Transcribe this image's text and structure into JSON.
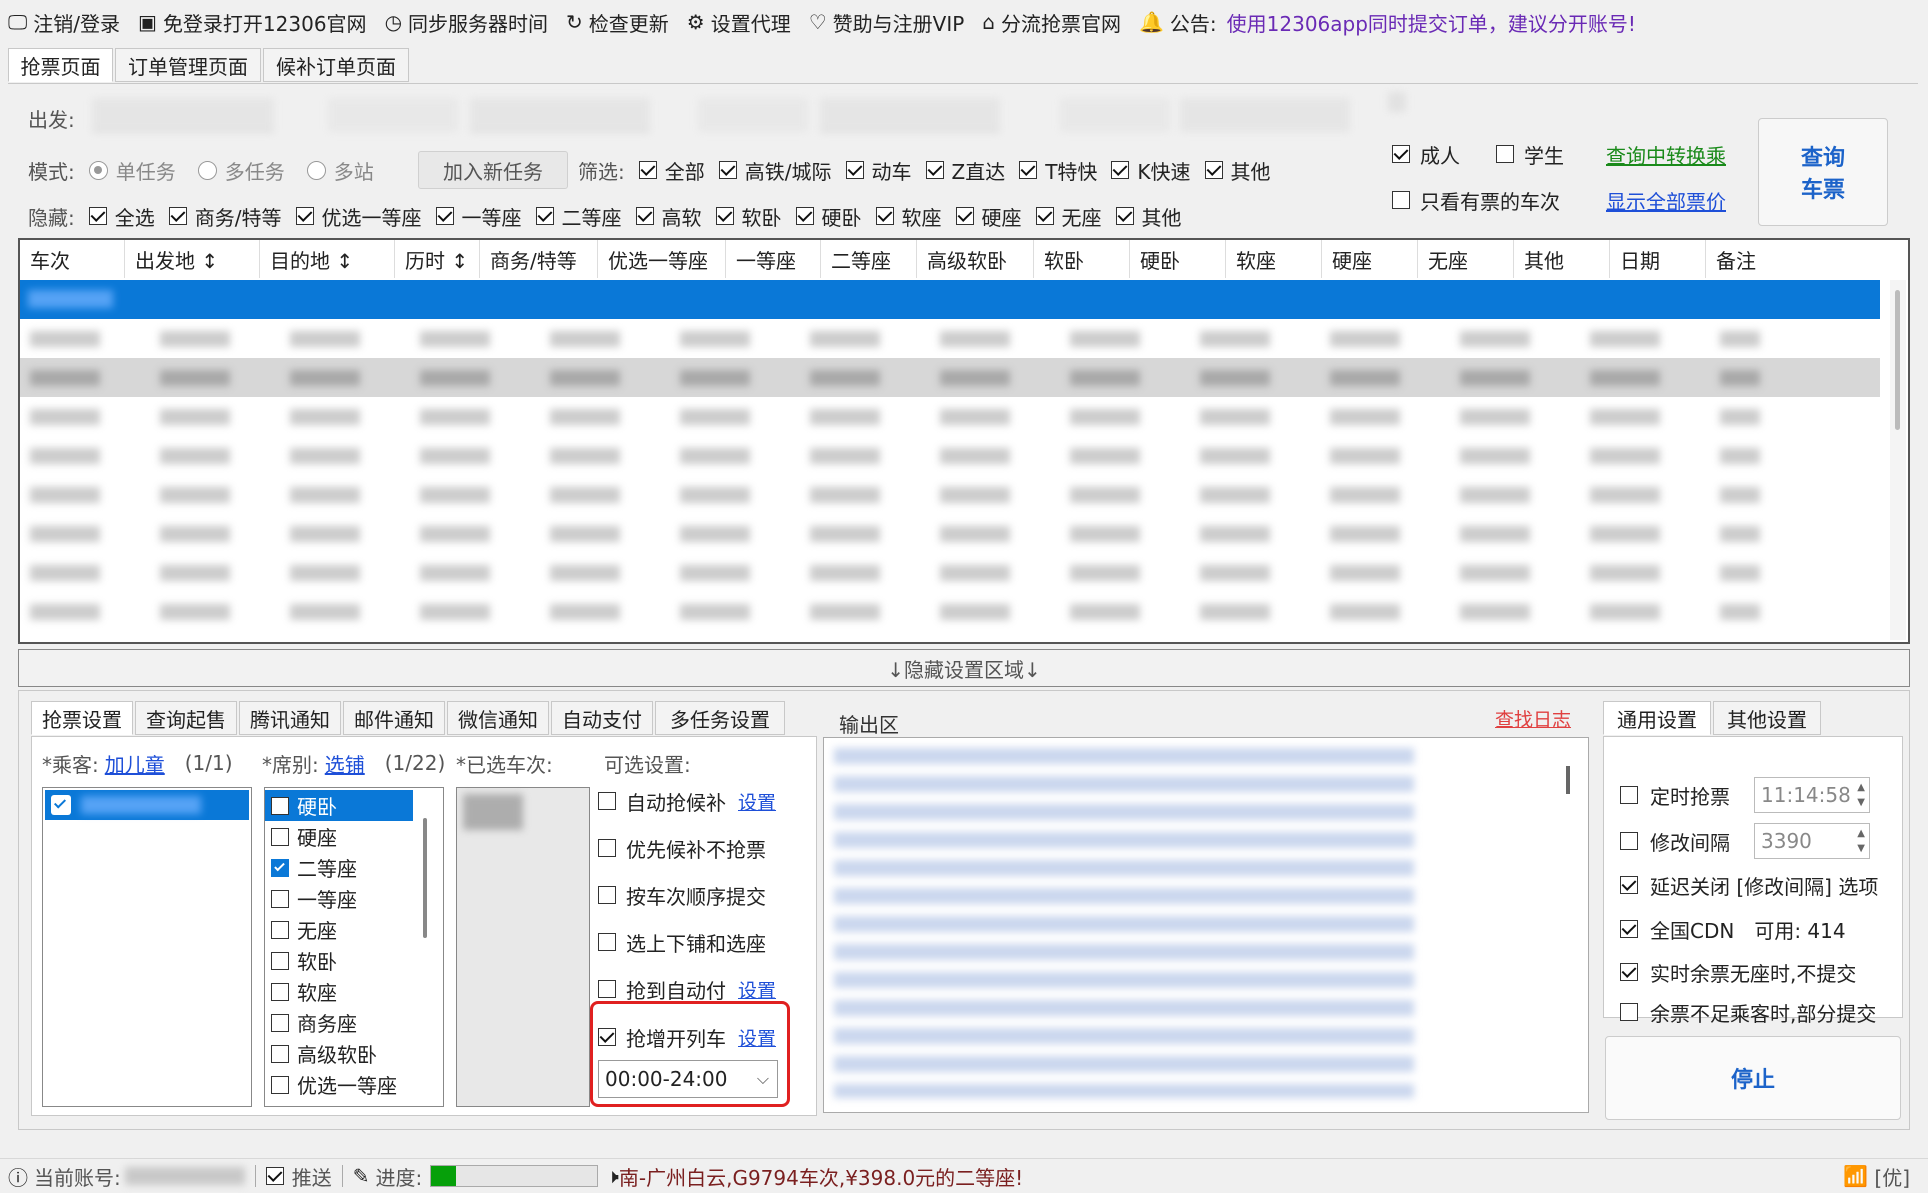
{
  "toolbar": {
    "items": [
      {
        "icon": "monitor-icon",
        "label": "注销/登录"
      },
      {
        "icon": "window-icon",
        "label": "免登录打开12306官网"
      },
      {
        "icon": "clock-icon",
        "label": "同步服务器时间"
      },
      {
        "icon": "refresh-icon",
        "label": "检查更新"
      },
      {
        "icon": "gear-icon",
        "label": "设置代理"
      },
      {
        "icon": "heart-icon",
        "label": "赞助与注册VIP"
      },
      {
        "icon": "home-icon",
        "label": "分流抢票官网"
      }
    ],
    "notice_label": "公告:",
    "notice_text": "使用12306app同时提交订单，建议分开账号!"
  },
  "main_tabs": [
    "抢票页面",
    "订单管理页面",
    "候补订单页面"
  ],
  "query": {
    "from_label": "出发:",
    "mode_label": "模式:",
    "modes": [
      "单任务",
      "多任务",
      "多站"
    ],
    "add_task": "加入新任务",
    "filter_label": "筛选:",
    "filters": [
      "全部",
      "高铁/城际",
      "动车",
      "Z直达",
      "T特快",
      "K快速",
      "其他"
    ],
    "hide_label": "隐藏:",
    "hides": [
      "全选",
      "商务/特等",
      "优选一等座",
      "一等座",
      "二等座",
      "高软",
      "软卧",
      "硬卧",
      "软座",
      "硬座",
      "无座",
      "其他"
    ],
    "adult": "成人",
    "student": "学生",
    "transfer_link": "查询中转换乘",
    "only_tickets": "只看有票的车次",
    "show_prices_link": "显示全部票价",
    "query_btn_line1": "查询",
    "query_btn_line2": "车票"
  },
  "table": {
    "headers": [
      "车次",
      "出发地 ↕",
      "目的地 ↕",
      "历时 ↕",
      "商务/特等",
      "优选一等座",
      "一等座",
      "二等座",
      "高级软卧",
      "软卧",
      "硬卧",
      "软座",
      "硬座",
      "无座",
      "其他",
      "日期",
      "备注"
    ]
  },
  "hidden_bar": "↓隐藏设置区域↓",
  "settings_tabs": [
    "抢票设置",
    "查询起售",
    "腾讯通知",
    "邮件通知",
    "微信通知",
    "自动支付",
    "多任务设置"
  ],
  "passenger": {
    "label": "*乘客:",
    "link": "加儿童",
    "count": "(1/1)"
  },
  "seat": {
    "label": "*席别:",
    "link": "选铺",
    "count": "(1/22)",
    "items": [
      {
        "name": "硬卧",
        "checked": false,
        "selected": true
      },
      {
        "name": "硬座",
        "checked": false,
        "selected": false
      },
      {
        "name": "二等座",
        "checked": true,
        "selected": false
      },
      {
        "name": "一等座",
        "checked": false,
        "selected": false
      },
      {
        "name": "无座",
        "checked": false,
        "selected": false
      },
      {
        "name": "软卧",
        "checked": false,
        "selected": false
      },
      {
        "name": "软座",
        "checked": false,
        "selected": false
      },
      {
        "name": "商务座",
        "checked": false,
        "selected": false
      },
      {
        "name": "高级软卧",
        "checked": false,
        "selected": false
      },
      {
        "name": "优选一等座",
        "checked": false,
        "selected": false
      }
    ]
  },
  "chosen_trains_label": "*已选车次:",
  "options": {
    "label": "可选设置:",
    "items": [
      {
        "label": "自动抢候补",
        "checked": false,
        "link": "设置"
      },
      {
        "label": "优先候补不抢票",
        "checked": false,
        "link": ""
      },
      {
        "label": "按车次顺序提交",
        "checked": false,
        "link": ""
      },
      {
        "label": "选上下铺和选座",
        "checked": false,
        "link": ""
      },
      {
        "label": "抢到自动付",
        "checked": false,
        "link": "设置"
      },
      {
        "label": "抢增开列车",
        "checked": true,
        "link": "设置"
      }
    ],
    "time_range": "00:00-24:00"
  },
  "output": {
    "label": "输出区",
    "log_link": "查找日志"
  },
  "general_tabs": [
    "通用设置",
    "其他设置"
  ],
  "general": {
    "timed_label": "定时抢票",
    "timed_value": "11:14:58",
    "interval_label": "修改间隔",
    "interval_value": "3390",
    "delay_close": "延迟关闭 [修改间隔] 选项",
    "cdn_label": "全国CDN",
    "cdn_avail": "可用: 414",
    "no_seat": "实时余票无座时,不提交",
    "partial": "余票不足乘客时,部分提交",
    "stop_btn": "停止"
  },
  "status": {
    "account_label": "当前账号:",
    "push_label": "推送",
    "progress_label": "进度:",
    "progress": 0.15,
    "message": "南-广州白云,G9794车次,¥398.0元的二等座!",
    "right_label": "[优]"
  },
  "colors": {
    "accent": "#0a78d7",
    "link": "#1e4fd8",
    "green_link": "#1a8a1a",
    "notice": "#6a2ab5",
    "red_link": "#e04040",
    "highlight_box": "#e02020"
  }
}
